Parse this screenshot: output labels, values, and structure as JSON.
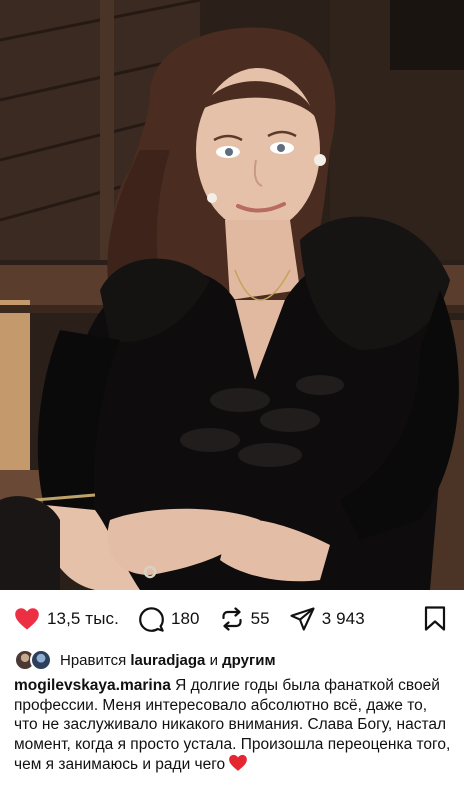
{
  "post": {
    "photo_alt": "",
    "counts": {
      "likes": "13,5 тыс.",
      "comments": "180",
      "reposts": "55",
      "shares": "3 943"
    },
    "liked_by": {
      "prefix": "Нравится",
      "user": "lauradjaga",
      "joiner": "и",
      "others": "другим"
    },
    "caption": {
      "username": "mogilevskaya.marina",
      "text": "Я долгие годы была фанаткой своей профессии. Меня интересовало абсолютно всё, даже то, что не заслуживало никакого внимания. Слава Богу, настал момент, когда я просто устала. Произошла переоценка того, чем я занимаюсь и ради чего"
    },
    "colors": {
      "like_active": "#ed2f44",
      "text": "#111111"
    },
    "icons": {
      "like": "heart-icon",
      "comment": "comment-icon",
      "repost": "repost-icon",
      "share": "share-icon",
      "save": "bookmark-icon"
    }
  }
}
